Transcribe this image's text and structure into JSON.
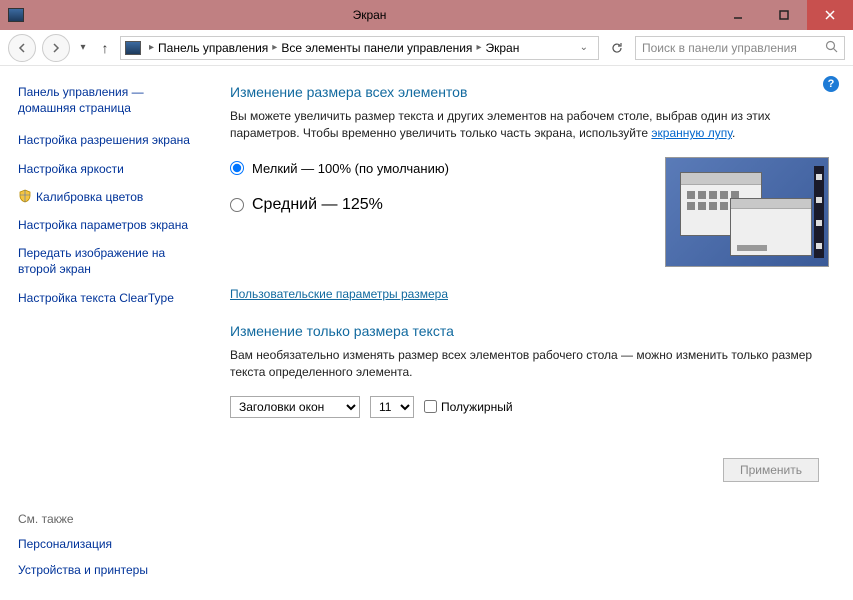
{
  "window": {
    "title": "Экран"
  },
  "breadcrumb": {
    "root": "Панель управления",
    "mid": "Все элементы панели управления",
    "leaf": "Экран"
  },
  "search": {
    "placeholder": "Поиск в панели управления"
  },
  "sidebar": {
    "home": "Панель управления — домашняя страница",
    "items": [
      "Настройка разрешения экрана",
      "Настройка яркости",
      "Калибровка цветов",
      "Настройка параметров экрана",
      "Передать изображение на второй экран",
      "Настройка текста ClearType"
    ],
    "related_heading": "См. также",
    "related": [
      "Персонализация",
      "Устройства и принтеры"
    ]
  },
  "main": {
    "heading1": "Изменение размера всех элементов",
    "desc1_a": "Вы можете увеличить размер текста и других элементов на рабочем столе, выбрав один из этих параметров. Чтобы временно увеличить только часть экрана, используйте ",
    "desc1_link": "экранную лупу",
    "desc1_b": ".",
    "radio_small": "Мелкий — 100% (по умолчанию)",
    "radio_medium": "Средний — 125%",
    "custom_link": "Пользовательские параметры размера",
    "heading2": "Изменение только размера текста",
    "desc2": "Вам необязательно изменять размер всех элементов рабочего стола — можно изменить только размер текста определенного элемента.",
    "dropdown_element": "Заголовки окон",
    "dropdown_size": "11",
    "checkbox_bold": "Полужирный",
    "apply": "Применить"
  }
}
